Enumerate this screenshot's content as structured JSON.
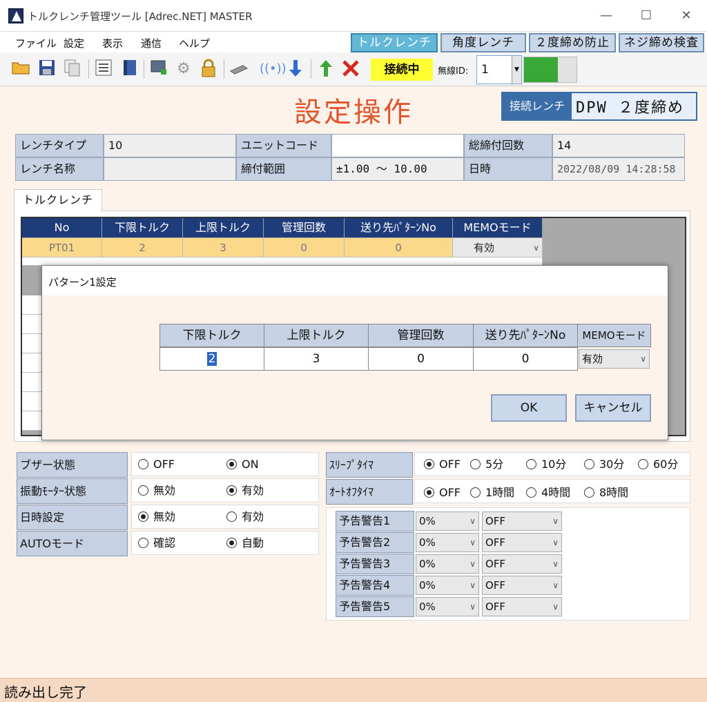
{
  "window": {
    "title": "トルクレンチ管理ツール [Adrec.NET] MASTER",
    "min": "—",
    "max": "☐",
    "close": "✕"
  },
  "menu": [
    "ファイル",
    "設定",
    "表示",
    "通信",
    "ヘルプ"
  ],
  "mode_buttons": [
    "トルクレンチ",
    "角度レンチ",
    "２度締め防止",
    "ネジ締め検査"
  ],
  "toolbar": {
    "icons": [
      "open-folder-icon",
      "save-icon",
      "copy-icon",
      "checklist-icon",
      "book-icon",
      "monitor-icon",
      "gear-icon",
      "lock-icon",
      "usb-icon",
      "wireless-icon",
      "download-arrow-icon",
      "upload-arrow-icon",
      "delete-x-icon"
    ],
    "status": "接続中",
    "wireless_label": "無線ID:",
    "wireless_id": "1",
    "signal_level": 0.64
  },
  "page_title": "設定操作",
  "connected_wrench": {
    "label": "接続レンチ",
    "value": "DPW ２度締め"
  },
  "info": {
    "wrench_type_label": "レンチタイプ",
    "wrench_type": "10",
    "unit_code_label": "ユニットコード",
    "unit_code": "",
    "total_count_label": "総締付回数",
    "total_count": "14",
    "wrench_name_label": "レンチ名称",
    "wrench_name": "",
    "range_label": "締付範囲",
    "range": "±1.00 〜 10.00",
    "datetime_label": "日時",
    "datetime": "2022/08/09 14:28:58"
  },
  "tab": "トルクレンチ",
  "grid": {
    "headers": [
      "No",
      "下限トルク",
      "上限トルク",
      "管理回数",
      "送り先ﾊﾟﾀｰﾝNo",
      "MEMOモード"
    ],
    "rows": [
      {
        "no": "PT01",
        "lower": "2",
        "upper": "3",
        "count": "0",
        "dest": "0",
        "memo": "有効"
      }
    ]
  },
  "dialog": {
    "title": "パターン1設定",
    "headers": [
      "下限トルク",
      "上限トルク",
      "管理回数",
      "送り先ﾊﾟﾀｰﾝNo",
      "MEMOモード"
    ],
    "values": {
      "lower": "2",
      "upper": "3",
      "count": "0",
      "dest": "0",
      "memo": "有効"
    },
    "ok": "OK",
    "cancel": "キャンセル"
  },
  "settings": {
    "buzzer": {
      "label": "ブザー状態",
      "opt1": "OFF",
      "opt2": "ON"
    },
    "vibration": {
      "label": "振動ﾓｰﾀｰ状態",
      "opt1": "無効",
      "opt2": "有効"
    },
    "datetime_set": {
      "label": "日時設定",
      "opt1": "無効",
      "opt2": "有効"
    },
    "auto_mode": {
      "label": "AUTOモード",
      "opt1": "確認",
      "opt2": "自動"
    },
    "sleep_timer": {
      "label": "ｽﾘｰﾌﾟﾀｲﾏ",
      "options": [
        "OFF",
        "5分",
        "10分",
        "30分",
        "60分"
      ]
    },
    "auto_off_timer": {
      "label": "ｵｰﾄｵﾌﾀｲﾏ",
      "options": [
        "OFF",
        "1時間",
        "4時間",
        "8時間"
      ]
    },
    "warnings": [
      {
        "label": "予告警告1",
        "pct": "0%",
        "state": "OFF"
      },
      {
        "label": "予告警告2",
        "pct": "0%",
        "state": "OFF"
      },
      {
        "label": "予告警告3",
        "pct": "0%",
        "state": "OFF"
      },
      {
        "label": "予告警告4",
        "pct": "0%",
        "state": "OFF"
      },
      {
        "label": "予告警告5",
        "pct": "0%",
        "state": "OFF"
      }
    ]
  },
  "status_bar": "読み出し完了",
  "colors": {
    "accent_title": "#e0552c",
    "header_blue": "#1f3c7a",
    "label_bg": "#c6d1e3",
    "selected_row": "#fbd98b",
    "connected": "#ffff33",
    "signal": "#3aa836"
  }
}
